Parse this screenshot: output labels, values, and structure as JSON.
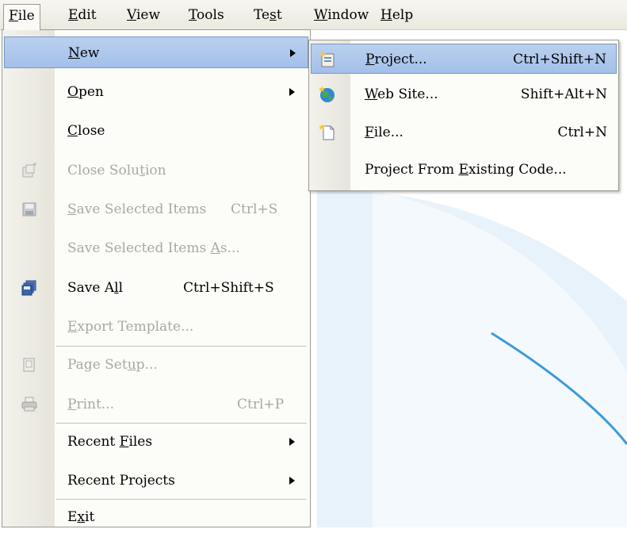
{
  "menubar": {
    "file": {
      "pre": "",
      "u": "F",
      "post": "ile"
    },
    "edit": {
      "pre": "",
      "u": "E",
      "post": "dit"
    },
    "view": {
      "pre": "",
      "u": "V",
      "post": "iew"
    },
    "tools": {
      "pre": "",
      "u": "T",
      "post": "ools"
    },
    "test": {
      "pre": "Te",
      "u": "s",
      "post": "t"
    },
    "window": {
      "pre": "",
      "u": "W",
      "post": "indow"
    },
    "help": {
      "pre": "",
      "u": "H",
      "post": "elp"
    }
  },
  "file_menu": {
    "new": {
      "pre": "",
      "u": "N",
      "post": "ew"
    },
    "open": {
      "pre": "",
      "u": "O",
      "post": "pen"
    },
    "close": {
      "pre": "",
      "u": "C",
      "post": "lose"
    },
    "close_solution": {
      "pre": "Close Solu",
      "u": "t",
      "post": "ion"
    },
    "save_selected": {
      "pre": "",
      "u": "S",
      "post": "ave Selected Items",
      "shortcut": "Ctrl+S"
    },
    "save_selected_as": {
      "pre": "Save Selected Items ",
      "u": "A",
      "post": "s..."
    },
    "save_all": {
      "pre": "Save A",
      "u": "l",
      "post": "l",
      "shortcut": "Ctrl+Shift+S"
    },
    "export_template": {
      "pre": "",
      "u": "E",
      "post": "xport Template..."
    },
    "page_setup": {
      "pre": "Page Set",
      "u": "u",
      "post": "p..."
    },
    "print": {
      "pre": "",
      "u": "P",
      "post": "rint...",
      "shortcut": "Ctrl+P"
    },
    "recent_files": {
      "pre": "Recent ",
      "u": "F",
      "post": "iles"
    },
    "recent_projects": {
      "pre": "Recent Pro",
      "u": "j",
      "post": "ects"
    },
    "exit": {
      "pre": "E",
      "u": "x",
      "post": "it"
    }
  },
  "new_submenu": {
    "project": {
      "pre": "",
      "u": "P",
      "post": "roject...",
      "shortcut": "Ctrl+Shift+N"
    },
    "web_site": {
      "pre": "",
      "u": "W",
      "post": "eb Site...",
      "shortcut": "Shift+Alt+N"
    },
    "file": {
      "pre": "",
      "u": "F",
      "post": "ile...",
      "shortcut": "Ctrl+N"
    },
    "existing": {
      "pre": "Project From ",
      "u": "E",
      "post": "xisting Code..."
    }
  },
  "icons": {
    "close_solution": "close-solution-icon",
    "save_selected": "save-disk-icon",
    "save_all": "save-all-icon",
    "page_setup": "page-setup-icon",
    "print": "printer-icon",
    "project": "new-project-icon",
    "web_site": "globe-icon",
    "file": "new-file-icon"
  },
  "colors": {
    "highlight": "#a3c0ea",
    "highlight_border": "#7997c6",
    "disabled_text": "#a9a7a2",
    "menubar_bg": "#ebe9df",
    "accent_blue": "#3a9ad9"
  }
}
